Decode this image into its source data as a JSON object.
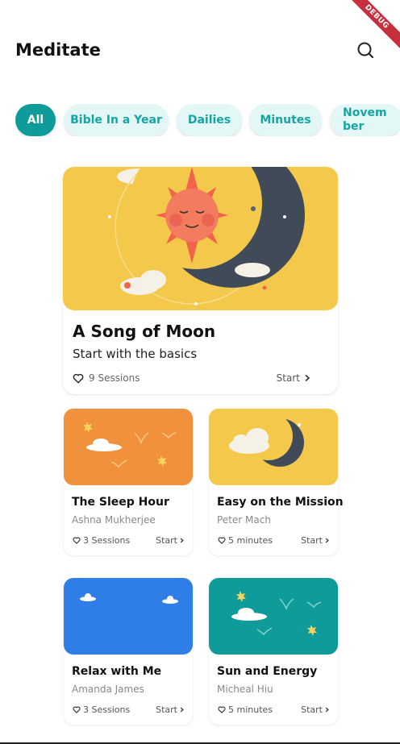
{
  "app": {
    "title": "Meditate",
    "debug_label": "DEBUG"
  },
  "chips": [
    {
      "label": "All",
      "active": true
    },
    {
      "label": "Bible In a Year",
      "active": false
    },
    {
      "label": "Dailies",
      "active": false
    },
    {
      "label": "Minutes",
      "active": false
    },
    {
      "label": "Novem\nber",
      "active": false
    }
  ],
  "featured": {
    "title": "A Song of Moon",
    "subtitle": "Start with the basics",
    "meta": "9 Sessions",
    "start": "Start"
  },
  "cards": [
    {
      "title": "The Sleep Hour",
      "author": "Ashna Mukherjee",
      "meta": "3 Sessions",
      "start": "Start",
      "bg": "#f1913c"
    },
    {
      "title": "Easy on the Mission",
      "author": "Peter Mach",
      "meta": "5 minutes",
      "start": "Start",
      "bg": "#f3c84b"
    },
    {
      "title": "Relax with Me",
      "author": "Amanda James",
      "meta": "3 Sessions",
      "start": "Start",
      "bg": "#2f7de6"
    },
    {
      "title": "Sun and Energy",
      "author": "Micheal Hiu",
      "meta": "5 minutes",
      "start": "Start",
      "bg": "#0e9b99"
    }
  ],
  "colors": {
    "accent": "#0e9b99",
    "chip_bg": "#e3f7f6",
    "chip_text": "#16a5a3",
    "featured_bg": "#f3c84b"
  },
  "icons": {
    "search": "search-icon",
    "heart": "heart-outline-icon",
    "chevron": "chevron-right-icon"
  }
}
